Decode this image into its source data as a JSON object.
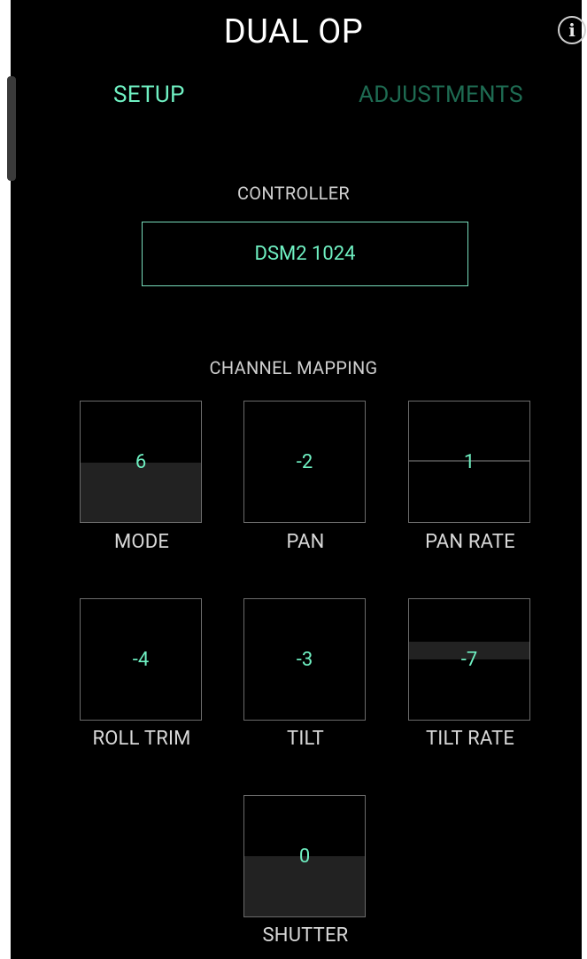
{
  "header": {
    "title": "DUAL OP",
    "info_icon": "info-icon",
    "info_glyph": "i"
  },
  "tabs": [
    {
      "label": "SETUP",
      "active": true
    },
    {
      "label": "ADJUSTMENTS",
      "active": false
    }
  ],
  "controller": {
    "heading": "CONTROLLER",
    "value": "DSM2 1024"
  },
  "channel_mapping": {
    "heading": "CHANNEL MAPPING",
    "channels": [
      {
        "label": "MODE",
        "value": "6"
      },
      {
        "label": "PAN",
        "value": "-2"
      },
      {
        "label": "PAN RATE",
        "value": "1"
      },
      {
        "label": "ROLL TRIM",
        "value": "-4"
      },
      {
        "label": "TILT",
        "value": "-3"
      },
      {
        "label": "TILT RATE",
        "value": "-7"
      },
      {
        "label": "SHUTTER",
        "value": "0"
      }
    ]
  },
  "colors": {
    "accent": "#6ff0c2",
    "inactive_tab": "#1e6b52",
    "background": "#000000",
    "tile_fill": "#222222"
  }
}
